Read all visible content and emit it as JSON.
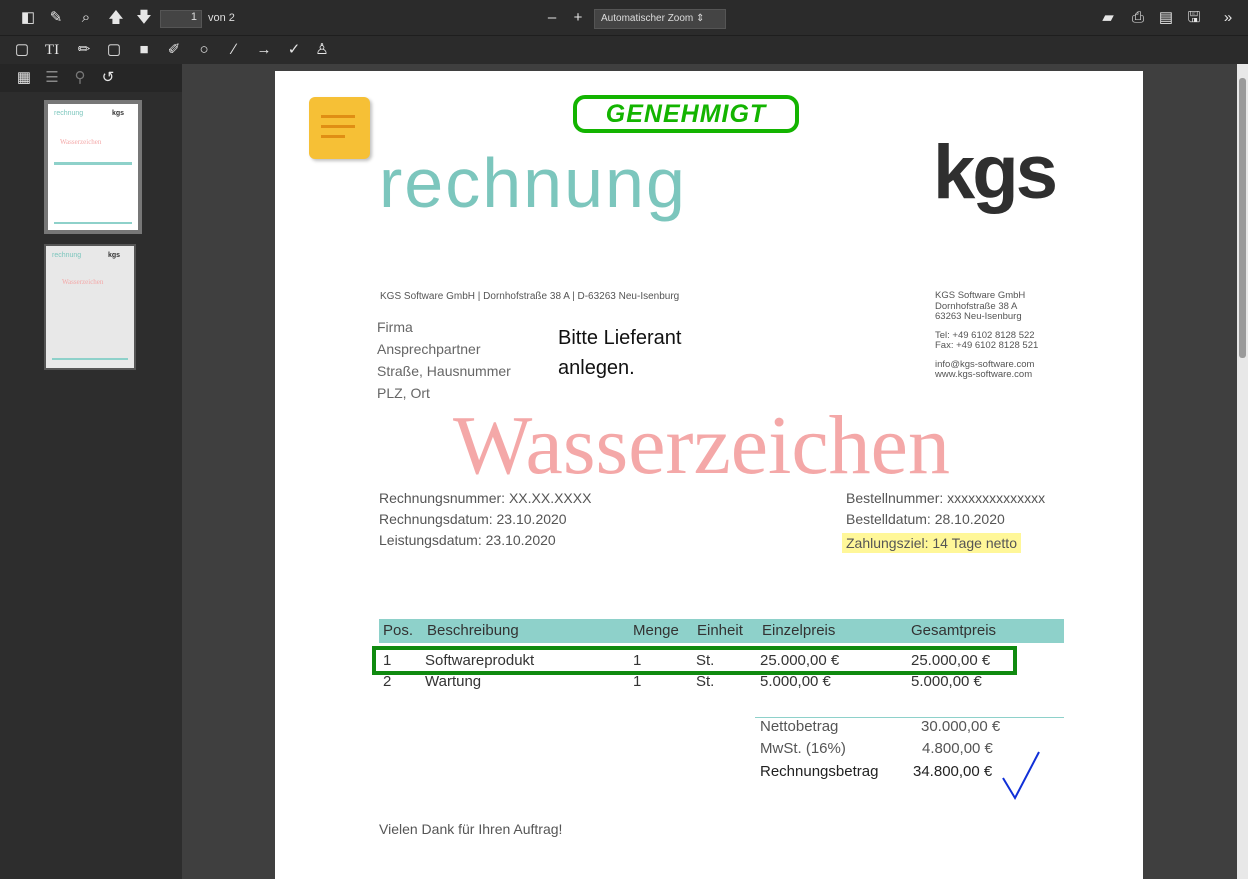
{
  "toolbar": {
    "page_number": "1",
    "page_of": "von 2",
    "zoom": "Automatischer Zoom",
    "zoom_out_label": "–",
    "zoom_in_label": "+",
    "more_label": "»"
  },
  "sidebar": {
    "thumb1": {
      "title": "rechnung",
      "logo": "kgs",
      "watermark": "Wasserzeichen"
    },
    "thumb2": {
      "title": "rechnung",
      "logo": "kgs",
      "watermark": "Wasserzeichen"
    }
  },
  "document": {
    "stamp": "GENEHMIGT",
    "title": "rechnung",
    "logo": "kgs",
    "sender_line": "KGS Software GmbH  |  Dornhofstraße 38 A  |  D-63263 Neu-Isenburg",
    "recipient": [
      "Firma",
      "Ansprechpartner",
      "Straße, Hausnummer",
      "PLZ, Ort"
    ],
    "note": [
      "Bitte Lieferant",
      "anlegen."
    ],
    "sender": [
      "KGS Software GmbH",
      "Dornhofstraße 38 A",
      "63263 Neu-Isenburg",
      "",
      "Tel: +49 6102 8128 522",
      "Fax: +49 6102 8128 521",
      "",
      "info@kgs-software.com",
      "www.kgs-software.com"
    ],
    "watermark": "Wasserzeichen",
    "meta_left": [
      "Rechnungsnummer: XX.XX.XXXX",
      "Rechnungsdatum: 23.10.2020",
      "Leistungsdatum: 23.10.2020"
    ],
    "meta_right": [
      "Bestellnummer: xxxxxxxxxxxxxx",
      "Bestelldatum: 28.10.2020"
    ],
    "payment_terms": "Zahlungsziel: 14 Tage netto",
    "table": {
      "headers": [
        "Pos.",
        "Beschreibung",
        "Menge",
        "Einheit",
        "Einzelpreis",
        "Gesamtpreis"
      ],
      "rows": [
        [
          "1",
          "Softwareprodukt",
          "1",
          "St.",
          "25.000,00 €",
          "25.000,00 €"
        ],
        [
          "2",
          "Wartung",
          "1",
          "St.",
          "5.000,00 €",
          "5.000,00 €"
        ]
      ]
    },
    "totals": [
      {
        "label": "Nettobetrag",
        "value": "30.000,00 €"
      },
      {
        "label": "MwSt. (16%)",
        "value": "4.800,00 €"
      },
      {
        "label": "Rechnungsbetrag",
        "value": "34.800,00 €"
      }
    ],
    "thanks": "Vielen Dank für Ihren Auftrag!"
  },
  "colors": {
    "accent": "#8ed1ca",
    "stamp": "#13b400",
    "highlight": "#fff799",
    "watermark": "#f4a8a8",
    "row_box": "#108a10"
  },
  "icons": [
    "sidebar-toggle-icon",
    "edit-icon",
    "search-icon",
    "previous-page-icon",
    "next-page-icon",
    "presentation-icon",
    "print-icon",
    "open-file-icon",
    "save-icon",
    "tools-icon",
    "note-icon",
    "text-icon",
    "pencil-icon",
    "rectangle-icon",
    "filled-rectangle-icon",
    "highlighter-icon",
    "ellipse-icon",
    "line-icon",
    "arrow-icon",
    "check-icon",
    "stamp-icon",
    "thumbnails-icon",
    "outline-icon",
    "attachments-icon",
    "history-icon"
  ]
}
